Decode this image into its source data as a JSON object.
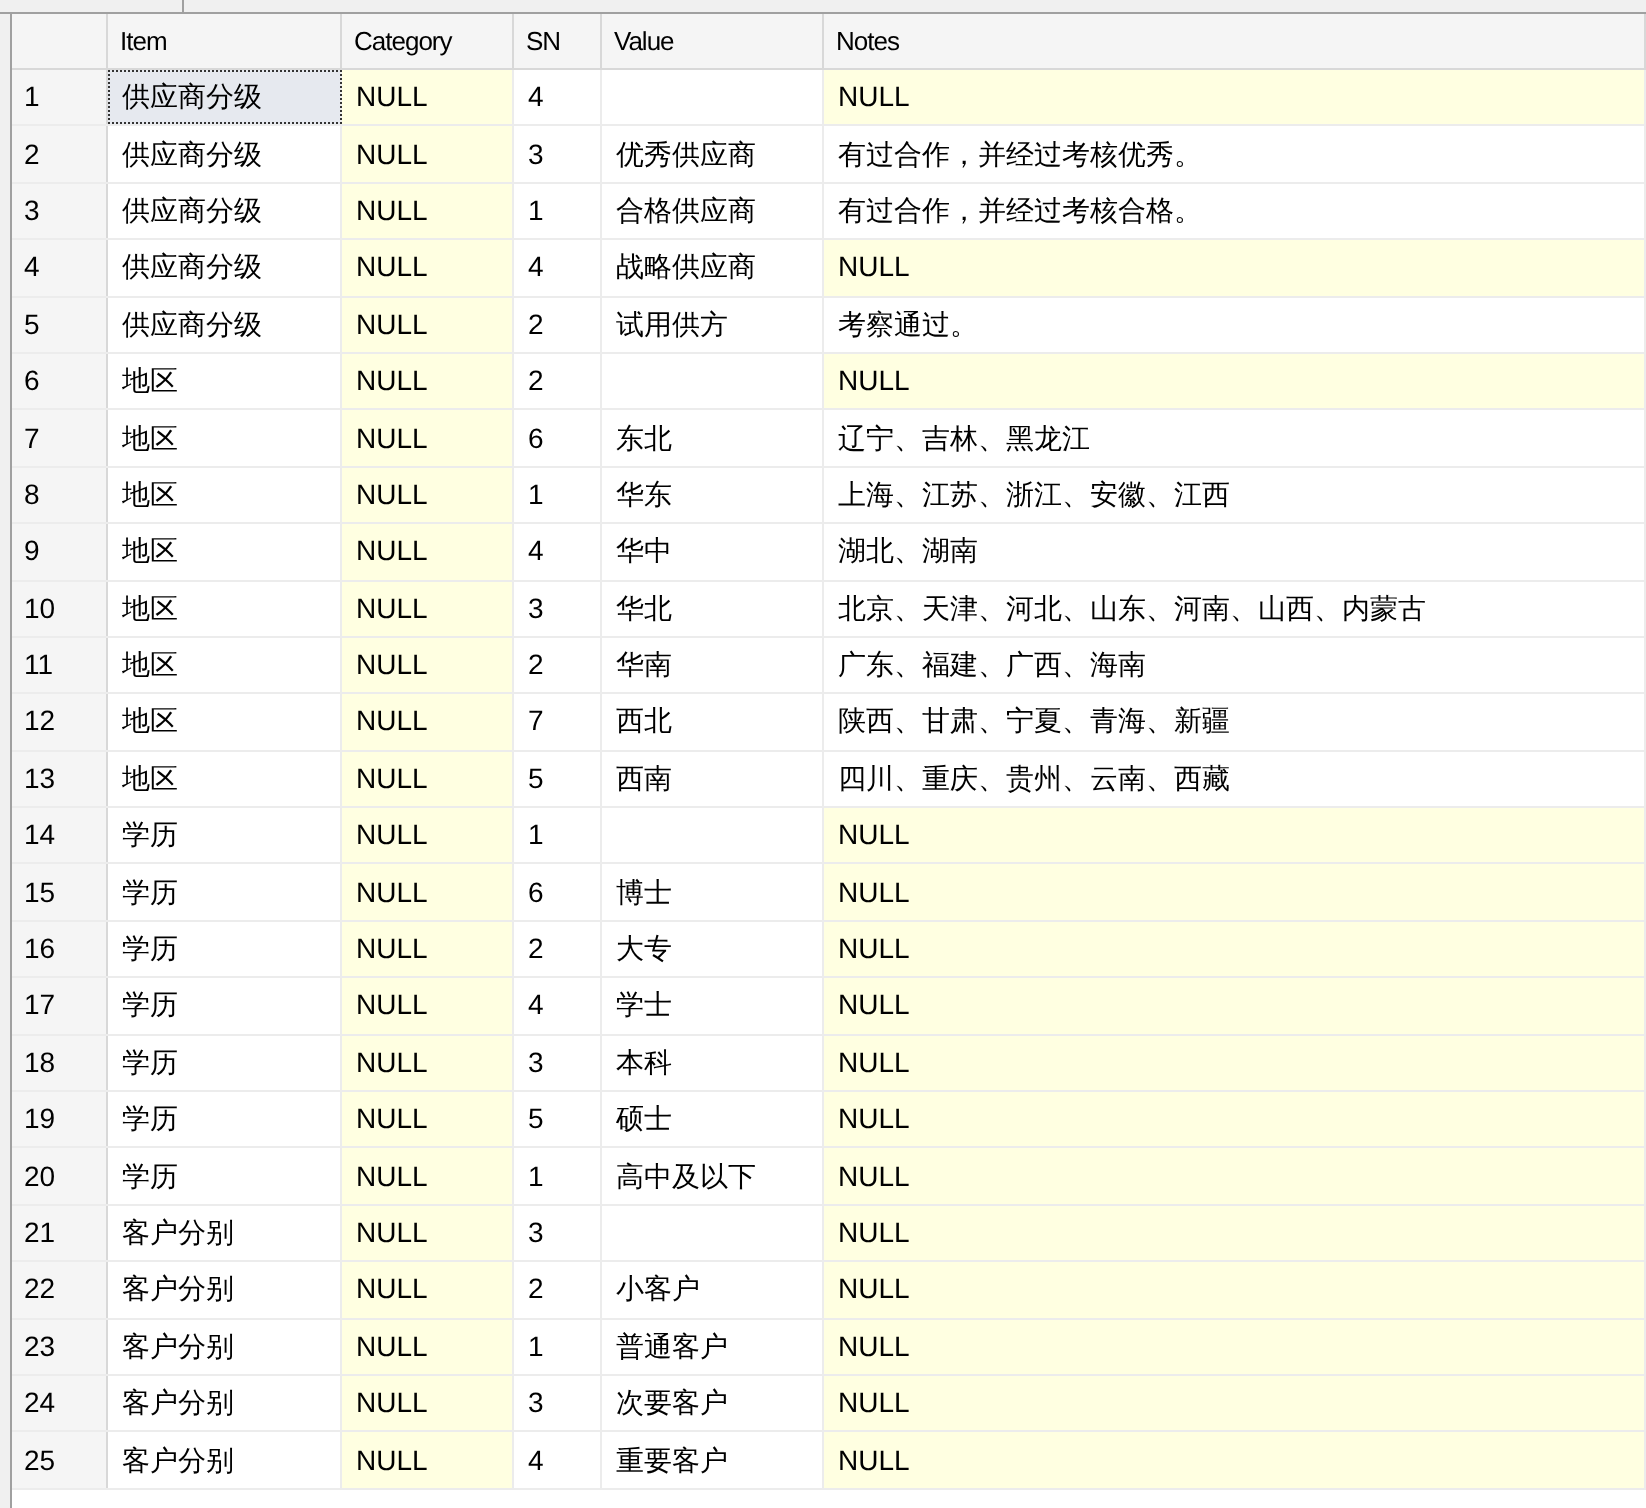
{
  "columns": [
    "Item",
    "Category",
    "SN",
    "Value",
    "Notes"
  ],
  "rows": [
    {
      "number": "1",
      "cells": [
        {
          "text": "供应商分级",
          "null": false,
          "selected": true
        },
        {
          "text": "NULL",
          "null": true,
          "selected": false
        },
        {
          "text": "4",
          "null": false,
          "selected": false
        },
        {
          "null": false,
          "selected": false
        },
        {
          "text": "NULL",
          "null": true,
          "selected": false
        }
      ]
    },
    {
      "number": "2",
      "cells": [
        {
          "text": "供应商分级",
          "null": false,
          "selected": false
        },
        {
          "text": "NULL",
          "null": true,
          "selected": false
        },
        {
          "text": "3",
          "null": false,
          "selected": false
        },
        {
          "text": "优秀供应商",
          "null": false,
          "selected": false
        },
        {
          "text": "有过合作，并经过考核优秀。",
          "null": false,
          "selected": false
        }
      ]
    },
    {
      "number": "3",
      "cells": [
        {
          "text": "供应商分级",
          "null": false,
          "selected": false
        },
        {
          "text": "NULL",
          "null": true,
          "selected": false
        },
        {
          "text": "1",
          "null": false,
          "selected": false
        },
        {
          "text": "合格供应商",
          "null": false,
          "selected": false
        },
        {
          "text": "有过合作，并经过考核合格。",
          "null": false,
          "selected": false
        }
      ]
    },
    {
      "number": "4",
      "cells": [
        {
          "text": "供应商分级",
          "null": false,
          "selected": false
        },
        {
          "text": "NULL",
          "null": true,
          "selected": false
        },
        {
          "text": "4",
          "null": false,
          "selected": false
        },
        {
          "text": "战略供应商",
          "null": false,
          "selected": false
        },
        {
          "text": "NULL",
          "null": true,
          "selected": false
        }
      ]
    },
    {
      "number": "5",
      "cells": [
        {
          "text": "供应商分级",
          "null": false,
          "selected": false
        },
        {
          "text": "NULL",
          "null": true,
          "selected": false
        },
        {
          "text": "2",
          "null": false,
          "selected": false
        },
        {
          "text": "试用供方",
          "null": false,
          "selected": false
        },
        {
          "text": "考察通过。",
          "null": false,
          "selected": false
        }
      ]
    },
    {
      "number": "6",
      "cells": [
        {
          "text": "地区",
          "null": false,
          "selected": false
        },
        {
          "text": "NULL",
          "null": true,
          "selected": false
        },
        {
          "text": "2",
          "null": false,
          "selected": false
        },
        {
          "null": false,
          "selected": false
        },
        {
          "text": "NULL",
          "null": true,
          "selected": false
        }
      ]
    },
    {
      "number": "7",
      "cells": [
        {
          "text": "地区",
          "null": false,
          "selected": false
        },
        {
          "text": "NULL",
          "null": true,
          "selected": false
        },
        {
          "text": "6",
          "null": false,
          "selected": false
        },
        {
          "text": "东北",
          "null": false,
          "selected": false
        },
        {
          "text": "辽宁、吉林、黑龙江",
          "null": false,
          "selected": false
        }
      ]
    },
    {
      "number": "8",
      "cells": [
        {
          "text": "地区",
          "null": false,
          "selected": false
        },
        {
          "text": "NULL",
          "null": true,
          "selected": false
        },
        {
          "text": "1",
          "null": false,
          "selected": false
        },
        {
          "text": "华东",
          "null": false,
          "selected": false
        },
        {
          "text": "上海、江苏、浙江、安徽、江西",
          "null": false,
          "selected": false
        }
      ]
    },
    {
      "number": "9",
      "cells": [
        {
          "text": "地区",
          "null": false,
          "selected": false
        },
        {
          "text": "NULL",
          "null": true,
          "selected": false
        },
        {
          "text": "4",
          "null": false,
          "selected": false
        },
        {
          "text": "华中",
          "null": false,
          "selected": false
        },
        {
          "text": "湖北、湖南",
          "null": false,
          "selected": false
        }
      ]
    },
    {
      "number": "10",
      "cells": [
        {
          "text": "地区",
          "null": false,
          "selected": false
        },
        {
          "text": "NULL",
          "null": true,
          "selected": false
        },
        {
          "text": "3",
          "null": false,
          "selected": false
        },
        {
          "text": "华北",
          "null": false,
          "selected": false
        },
        {
          "text": "北京、天津、河北、山东、河南、山西、内蒙古",
          "null": false,
          "selected": false
        }
      ]
    },
    {
      "number": "11",
      "cells": [
        {
          "text": "地区",
          "null": false,
          "selected": false
        },
        {
          "text": "NULL",
          "null": true,
          "selected": false
        },
        {
          "text": "2",
          "null": false,
          "selected": false
        },
        {
          "text": "华南",
          "null": false,
          "selected": false
        },
        {
          "text": "广东、福建、广西、海南",
          "null": false,
          "selected": false
        }
      ]
    },
    {
      "number": "12",
      "cells": [
        {
          "text": "地区",
          "null": false,
          "selected": false
        },
        {
          "text": "NULL",
          "null": true,
          "selected": false
        },
        {
          "text": "7",
          "null": false,
          "selected": false
        },
        {
          "text": "西北",
          "null": false,
          "selected": false
        },
        {
          "text": "陕西、甘肃、宁夏、青海、新疆",
          "null": false,
          "selected": false
        }
      ]
    },
    {
      "number": "13",
      "cells": [
        {
          "text": "地区",
          "null": false,
          "selected": false
        },
        {
          "text": "NULL",
          "null": true,
          "selected": false
        },
        {
          "text": "5",
          "null": false,
          "selected": false
        },
        {
          "text": "西南",
          "null": false,
          "selected": false
        },
        {
          "text": "四川、重庆、贵州、云南、西藏",
          "null": false,
          "selected": false
        }
      ]
    },
    {
      "number": "14",
      "cells": [
        {
          "text": "学历",
          "null": false,
          "selected": false
        },
        {
          "text": "NULL",
          "null": true,
          "selected": false
        },
        {
          "text": "1",
          "null": false,
          "selected": false
        },
        {
          "null": false,
          "selected": false
        },
        {
          "text": "NULL",
          "null": true,
          "selected": false
        }
      ]
    },
    {
      "number": "15",
      "cells": [
        {
          "text": "学历",
          "null": false,
          "selected": false
        },
        {
          "text": "NULL",
          "null": true,
          "selected": false
        },
        {
          "text": "6",
          "null": false,
          "selected": false
        },
        {
          "text": "博士",
          "null": false,
          "selected": false
        },
        {
          "text": "NULL",
          "null": true,
          "selected": false
        }
      ]
    },
    {
      "number": "16",
      "cells": [
        {
          "text": "学历",
          "null": false,
          "selected": false
        },
        {
          "text": "NULL",
          "null": true,
          "selected": false
        },
        {
          "text": "2",
          "null": false,
          "selected": false
        },
        {
          "text": "大专",
          "null": false,
          "selected": false
        },
        {
          "text": "NULL",
          "null": true,
          "selected": false
        }
      ]
    },
    {
      "number": "17",
      "cells": [
        {
          "text": "学历",
          "null": false,
          "selected": false
        },
        {
          "text": "NULL",
          "null": true,
          "selected": false
        },
        {
          "text": "4",
          "null": false,
          "selected": false
        },
        {
          "text": "学士",
          "null": false,
          "selected": false
        },
        {
          "text": "NULL",
          "null": true,
          "selected": false
        }
      ]
    },
    {
      "number": "18",
      "cells": [
        {
          "text": "学历",
          "null": false,
          "selected": false
        },
        {
          "text": "NULL",
          "null": true,
          "selected": false
        },
        {
          "text": "3",
          "null": false,
          "selected": false
        },
        {
          "text": "本科",
          "null": false,
          "selected": false
        },
        {
          "text": "NULL",
          "null": true,
          "selected": false
        }
      ]
    },
    {
      "number": "19",
      "cells": [
        {
          "text": "学历",
          "null": false,
          "selected": false
        },
        {
          "text": "NULL",
          "null": true,
          "selected": false
        },
        {
          "text": "5",
          "null": false,
          "selected": false
        },
        {
          "text": "硕士",
          "null": false,
          "selected": false
        },
        {
          "text": "NULL",
          "null": true,
          "selected": false
        }
      ]
    },
    {
      "number": "20",
      "cells": [
        {
          "text": "学历",
          "null": false,
          "selected": false
        },
        {
          "text": "NULL",
          "null": true,
          "selected": false
        },
        {
          "text": "1",
          "null": false,
          "selected": false
        },
        {
          "text": "高中及以下",
          "null": false,
          "selected": false
        },
        {
          "text": "NULL",
          "null": true,
          "selected": false
        }
      ]
    },
    {
      "number": "21",
      "cells": [
        {
          "text": "客户分别",
          "null": false,
          "selected": false
        },
        {
          "text": "NULL",
          "null": true,
          "selected": false
        },
        {
          "text": "3",
          "null": false,
          "selected": false
        },
        {
          "null": false,
          "selected": false
        },
        {
          "text": "NULL",
          "null": true,
          "selected": false
        }
      ]
    },
    {
      "number": "22",
      "cells": [
        {
          "text": "客户分别",
          "null": false,
          "selected": false
        },
        {
          "text": "NULL",
          "null": true,
          "selected": false
        },
        {
          "text": "2",
          "null": false,
          "selected": false
        },
        {
          "text": "小客户",
          "null": false,
          "selected": false
        },
        {
          "text": "NULL",
          "null": true,
          "selected": false
        }
      ]
    },
    {
      "number": "23",
      "cells": [
        {
          "text": "客户分别",
          "null": false,
          "selected": false
        },
        {
          "text": "NULL",
          "null": true,
          "selected": false
        },
        {
          "text": "1",
          "null": false,
          "selected": false
        },
        {
          "text": "普通客户",
          "null": false,
          "selected": false
        },
        {
          "text": "NULL",
          "null": true,
          "selected": false
        }
      ]
    },
    {
      "number": "24",
      "cells": [
        {
          "text": "客户分别",
          "null": false,
          "selected": false
        },
        {
          "text": "NULL",
          "null": true,
          "selected": false
        },
        {
          "text": "3",
          "null": false,
          "selected": false
        },
        {
          "text": "次要客户",
          "null": false,
          "selected": false
        },
        {
          "text": "NULL",
          "null": true,
          "selected": false
        }
      ]
    },
    {
      "number": "25",
      "cells": [
        {
          "text": "客户分别",
          "null": false,
          "selected": false
        },
        {
          "text": "NULL",
          "null": true,
          "selected": false
        },
        {
          "text": "4",
          "null": false,
          "selected": false
        },
        {
          "text": "重要客户",
          "null": false,
          "selected": false
        },
        {
          "text": "NULL",
          "null": true,
          "selected": false
        }
      ]
    }
  ]
}
